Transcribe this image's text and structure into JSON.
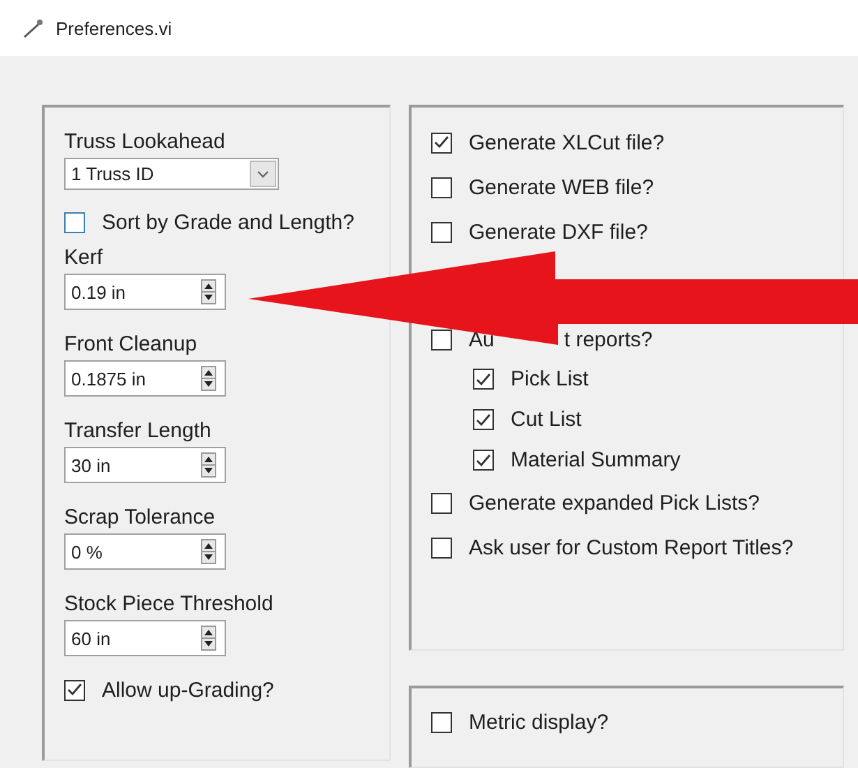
{
  "window": {
    "title": "Preferences.vi"
  },
  "left_group": {
    "lookahead": {
      "label": "Truss Lookahead",
      "value": "1 Truss ID"
    },
    "sort": {
      "label": "Sort by Grade and Length?",
      "checked": false
    },
    "spinners": [
      {
        "label": "Kerf",
        "value": "0.19 in"
      },
      {
        "label": "Front Cleanup",
        "value": "0.1875 in"
      },
      {
        "label": "Transfer Length",
        "value": "30 in"
      },
      {
        "label": "Scrap Tolerance",
        "value": "0 %"
      },
      {
        "label": "Stock Piece Threshold",
        "value": "60 in"
      }
    ],
    "allow_upgrading": {
      "label": "Allow up-Grading?",
      "checked": true
    }
  },
  "right_group": {
    "options": [
      {
        "label": "Generate XLCut file?",
        "checked": true
      },
      {
        "label": "Generate WEB file?",
        "checked": false
      },
      {
        "label": "Generate DXF file?",
        "checked": false
      },
      {
        "label_visible_start": "Au",
        "label_visible_end": "t reports?",
        "checked": false,
        "children": [
          {
            "label": "Pick List",
            "checked": true
          },
          {
            "label": "Cut List",
            "checked": true
          },
          {
            "label": "Material Summary",
            "checked": true
          }
        ]
      },
      {
        "label": "Generate expanded Pick Lists?",
        "checked": false
      },
      {
        "label": "Ask user for Custom Report Titles?",
        "checked": false
      }
    ]
  },
  "bottom_group": {
    "metric": {
      "label": "Metric display?",
      "checked": false
    }
  }
}
